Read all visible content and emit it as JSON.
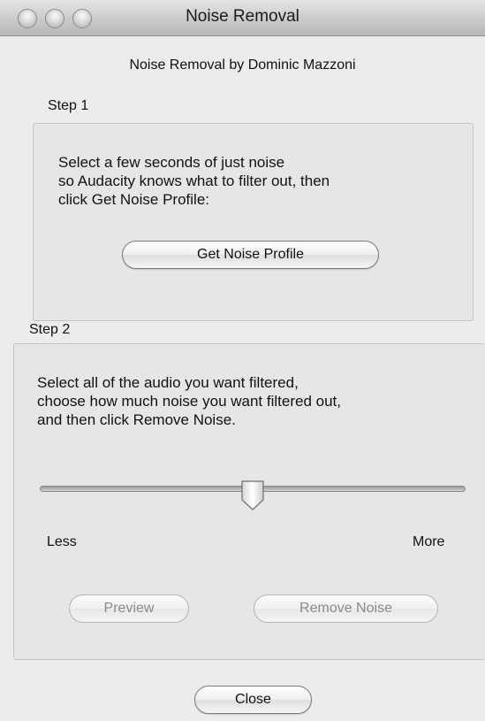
{
  "window": {
    "title": "Noise Removal"
  },
  "subtitle": "Noise Removal by Dominic Mazzoni",
  "step1": {
    "label": "Step 1",
    "lines": [
      "Select a few seconds of just noise",
      "so Audacity knows what to filter out, then",
      "click Get Noise Profile:"
    ],
    "button": "Get Noise Profile"
  },
  "step2": {
    "label": "Step 2",
    "lines": [
      "Select all of the audio you want filtered,",
      "choose how much noise you want filtered out,",
      "and then click Remove Noise."
    ],
    "slider": {
      "value_fraction": 0.5,
      "min_label": "Less",
      "max_label": "More"
    },
    "preview_button": "Preview",
    "remove_button": "Remove Noise"
  },
  "close_button": "Close",
  "colors": {
    "window_bg": "#ececec",
    "group_bg": "#e6e6e6",
    "disabled_text": "#8a8a8a"
  }
}
